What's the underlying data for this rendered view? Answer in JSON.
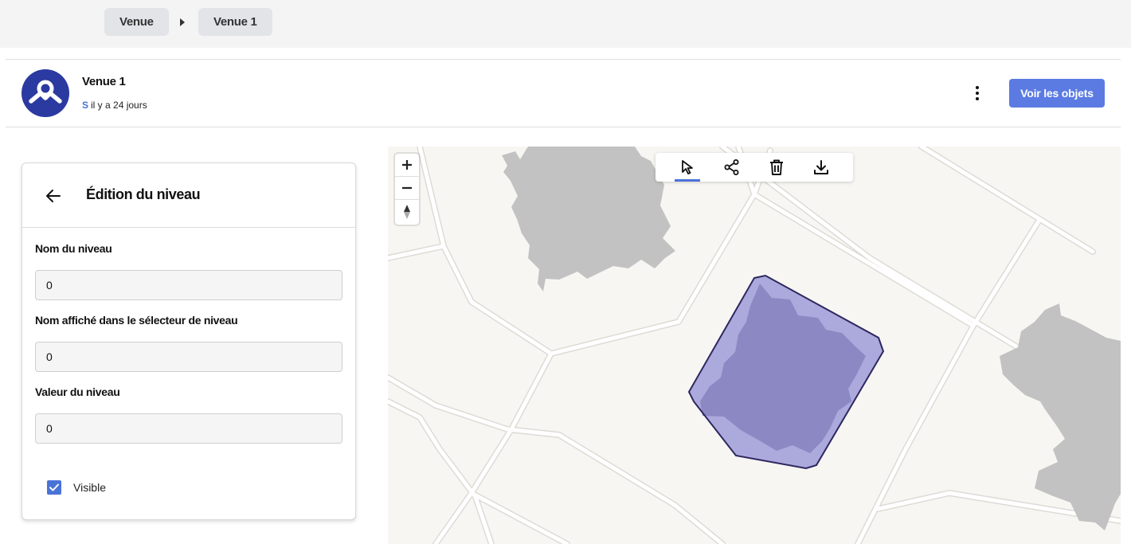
{
  "breadcrumb": {
    "items": [
      {
        "label": "Venue"
      },
      {
        "label": "Venue 1"
      }
    ]
  },
  "header": {
    "title": "Venue 1",
    "user_initial": "S",
    "updated": "il y a 24 jours",
    "primary_button": "Voir les objets",
    "more_icon": "more-vertical-icon",
    "avatar_icon": "brand-logo-icon"
  },
  "panel": {
    "title": "Édition du niveau",
    "back_icon": "arrow-left-icon",
    "fields": [
      {
        "label": "Nom du niveau",
        "value": "0"
      },
      {
        "label": "Nom affiché dans le sélecteur de niveau",
        "value": "0"
      },
      {
        "label": "Valeur du niveau",
        "value": "0"
      }
    ],
    "visible": {
      "label": "Visible",
      "checked": true
    }
  },
  "map": {
    "zoom_controls": [
      "zoom-in-icon",
      "zoom-out-icon",
      "compass-icon"
    ],
    "tools": [
      {
        "name": "select-tool",
        "icon": "cursor-arrow-icon",
        "active": true
      },
      {
        "name": "share-tool",
        "icon": "share-nodes-icon",
        "active": false
      },
      {
        "name": "delete-tool",
        "icon": "trash-icon",
        "active": false
      },
      {
        "name": "download-tool",
        "icon": "download-icon",
        "active": false
      }
    ]
  },
  "colors": {
    "accent": "#5b7be3",
    "brand": "#2b3aa0",
    "polygon_fill": "#8a86c4",
    "polygon_stroke": "#2d2760",
    "building": "#c2c2c2",
    "map_bg": "#f8f6f2"
  }
}
